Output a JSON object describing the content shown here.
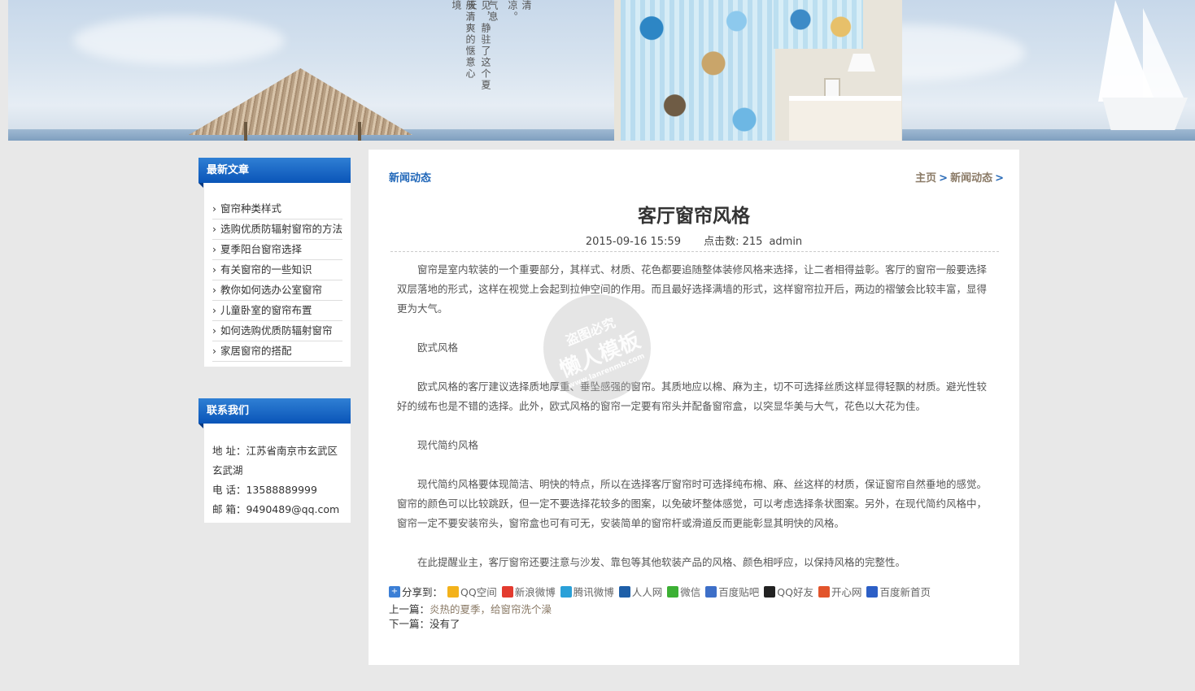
{
  "banner": {
    "poem_columns": [
      "清凉。",
      "气息",
      "见，静驻了这个夏天……",
      "般清爽的惬意心境"
    ]
  },
  "sidebar": {
    "latest": {
      "title": "最新文章",
      "items": [
        {
          "label": "窗帘种类样式"
        },
        {
          "label": "选购优质防辐射窗帘的方法"
        },
        {
          "label": "夏季阳台窗帘选择"
        },
        {
          "label": "有关窗帘的一些知识"
        },
        {
          "label": "教你如何选办公室窗帘"
        },
        {
          "label": "儿童卧室的窗帘布置"
        },
        {
          "label": "如何选购优质防辐射窗帘"
        },
        {
          "label": "家居窗帘的搭配"
        }
      ]
    },
    "contact": {
      "title": "联系我们",
      "address": "地 址：江苏省南京市玄武区玄武湖",
      "phone": "电 话：13588889999",
      "email": "邮 箱：9490489@qq.com"
    }
  },
  "main": {
    "section_title": "新闻动态",
    "breadcrumb": {
      "home": "主页",
      "current": "新闻动态",
      "sep": ">"
    },
    "article_title": "客厅窗帘风格",
    "date": "2015-09-16 15:59",
    "views": "点击数: 215",
    "author": "admin",
    "paragraphs": [
      "窗帘是室内软装的一个重要部分，其样式、材质、花色都要追随整体装修风格来选择，让二者相得益彰。客厅的窗帘一般要选择双层落地的形式，这样在视觉上会起到拉伸空间的作用。而且最好选择满墙的形式，这样窗帘拉开后，两边的褶皱会比较丰富，显得更为大气。",
      "欧式风格",
      "欧式风格的客厅建议选择质地厚重、垂坠感强的窗帘。其质地应以棉、麻为主，切不可选择丝质这样显得轻飘的材质。避光性较好的绒布也是不错的选择。此外，欧式风格的窗帘一定要有帘头并配备窗帘盒，以突显华美与大气，花色以大花为佳。",
      "现代简约风格",
      "现代简约风格要体现简洁、明快的特点，所以在选择客厅窗帘时可选择纯布棉、麻、丝这样的材质，保证窗帘自然垂地的感觉。窗帘的颜色可以比较跳跃，但一定不要选择花较多的图案，以免破坏整体感觉，可以考虑选择条状图案。另外，在现代简约风格中，窗帘一定不要安装帘头，窗帘盒也可有可无，安装简单的窗帘杆或滑道反而更能彰显其明快的风格。",
      "在此提醒业主，客厅窗帘还要注意与沙发、靠包等其他软装产品的风格、颜色相呼应，以保持风格的完整性。"
    ],
    "share": {
      "label": "分享到：",
      "items": [
        {
          "label": "QQ空间",
          "color": "#f3b21b"
        },
        {
          "label": "新浪微博",
          "color": "#e33b2f"
        },
        {
          "label": "腾讯微博",
          "color": "#2aa0d8"
        },
        {
          "label": "人人网",
          "color": "#1e5fa8"
        },
        {
          "label": "微信",
          "color": "#3cb034"
        },
        {
          "label": "百度贴吧",
          "color": "#3d6fc8"
        },
        {
          "label": "QQ好友",
          "color": "#222222"
        },
        {
          "label": "开心网",
          "color": "#e2542b"
        },
        {
          "label": "百度新首页",
          "color": "#2c5fc6"
        }
      ]
    },
    "prev_label": "上一篇：",
    "prev_link": "炎热的夏季，给窗帘洗个澡",
    "next_label": "下一篇：",
    "next_text": "没有了"
  },
  "watermark": {
    "line1": "盗图必究",
    "line2": "懒人模板",
    "line3": "www.lanrenmb.com"
  }
}
